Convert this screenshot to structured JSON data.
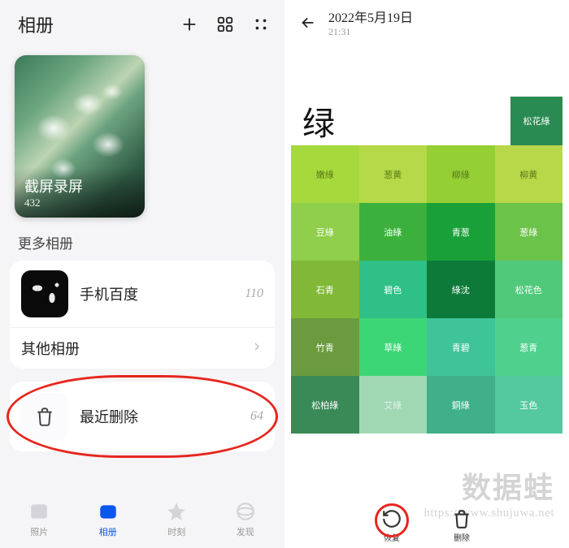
{
  "left": {
    "title": "相册",
    "album": {
      "name": "截屏录屏",
      "count": "432"
    },
    "section": "更多相册",
    "rows": [
      {
        "label": "手机百度",
        "count": "110"
      },
      {
        "label": "其他相册"
      }
    ],
    "recent": {
      "label": "最近删除",
      "count": "64"
    },
    "tabs": [
      {
        "label": "照片"
      },
      {
        "label": "相册"
      },
      {
        "label": "时刻"
      },
      {
        "label": "发现"
      }
    ]
  },
  "right": {
    "date": "2022年5月19日",
    "time": "21:31",
    "title": "绿",
    "title_chip": "松花綠",
    "cells": [
      {
        "label": "嫩綠",
        "bg": "#a6d93b",
        "fg": "#5a7a1a"
      },
      {
        "label": "葱黄",
        "bg": "#b5d948",
        "fg": "#5a7a1a"
      },
      {
        "label": "柳綠",
        "bg": "#94cf33",
        "fg": "#5a7a1a"
      },
      {
        "label": "柳黄",
        "bg": "#b8d84a",
        "fg": "#5a7a1a"
      },
      {
        "label": "豆綠",
        "bg": "#8fcf4b",
        "fg": "#ffffff"
      },
      {
        "label": "油綠",
        "bg": "#3cb03c",
        "fg": "#ffffff"
      },
      {
        "label": "青葱",
        "bg": "#1aa038",
        "fg": "#ffffff"
      },
      {
        "label": "葱綠",
        "bg": "#6bc349",
        "fg": "#ffffff"
      },
      {
        "label": "石青",
        "bg": "#82b838",
        "fg": "#ffffff"
      },
      {
        "label": "碧色",
        "bg": "#2fc088",
        "fg": "#ffffff"
      },
      {
        "label": "綠沈",
        "bg": "#0d7a3a",
        "fg": "#ffffff"
      },
      {
        "label": "松花色",
        "bg": "#51c97a",
        "fg": "#ffffff"
      },
      {
        "label": "竹青",
        "bg": "#6b9b3e",
        "fg": "#ffffff"
      },
      {
        "label": "草綠",
        "bg": "#3dd676",
        "fg": "#ffffff"
      },
      {
        "label": "青碧",
        "bg": "#3fc49a",
        "fg": "#ffffff"
      },
      {
        "label": "葱青",
        "bg": "#4fd18d",
        "fg": "#ffffff"
      },
      {
        "label": "松柏綠",
        "bg": "#3a8a57",
        "fg": "#ffffff"
      },
      {
        "label": "艾綠",
        "bg": "#a0d8b4",
        "fg": "#e0f3e7"
      },
      {
        "label": "銅綠",
        "bg": "#3fb089",
        "fg": "#ffffff"
      },
      {
        "label": "玉色",
        "bg": "#54c9a0",
        "fg": "#ffffff"
      }
    ],
    "watermark": {
      "big": "数据蛙",
      "url": "https://www.shujuwa.net"
    },
    "actions": {
      "restore": "恢复",
      "delete": "删除"
    }
  }
}
